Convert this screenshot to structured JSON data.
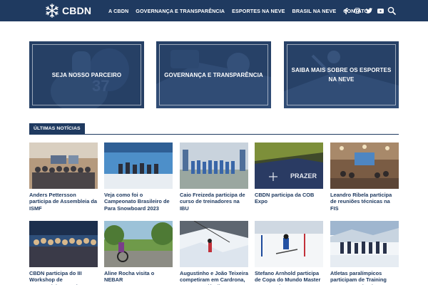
{
  "brand": {
    "name": "CBDN",
    "logo_icon": "snowflake-icon",
    "accent": "#1f3a60",
    "link_color": "#1f3a60"
  },
  "nav": {
    "items": [
      {
        "label": "A CBDN"
      },
      {
        "label": "GOVERNANÇA E TRANSPARÊNCIA"
      },
      {
        "label": "ESPORTES NA NEVE"
      },
      {
        "label": "BRASIL NA NEVE"
      },
      {
        "label": "CONTATO"
      }
    ]
  },
  "social": {
    "facebook": "f",
    "instagram": "◎",
    "twitter": "🐦",
    "youtube": "▶"
  },
  "features": [
    {
      "label": "SEJA NOSSO PARCEIRO"
    },
    {
      "label": "GOVERNANÇA E TRANSPARÊNCIA"
    },
    {
      "label": "SAIBA MAIS SOBRE OS ESPORTES NA NEVE"
    }
  ],
  "news": {
    "section_title": "ÚLTIMAS NOTÍCIAS",
    "items": [
      {
        "title": "Anders Pettersson participa de Assembleia da ISMF"
      },
      {
        "title": "Veja como foi o Campeonato Brasileiro de Para Snowboard 2023"
      },
      {
        "title": "Caio Freizeda participa de curso de treinadores na IBU"
      },
      {
        "title": "CBDN participa da COB Expo"
      },
      {
        "title": "Leandro Ribela participa de reuniões técnicas na FIS"
      },
      {
        "title": "CBDN participa do III Workshop de Desenvolvimento do COB"
      },
      {
        "title": "Aline Rocha visita o NEBAR"
      },
      {
        "title": "Augustinho e João Teixeira competiram em Cardrona, na Nova Zelândia"
      },
      {
        "title": "Stefano Arnhold participa de Copa do Mundo Master na Argentina"
      },
      {
        "title": "Atletas paralímpicos participam de Training Camp em Ushuaia"
      }
    ]
  }
}
